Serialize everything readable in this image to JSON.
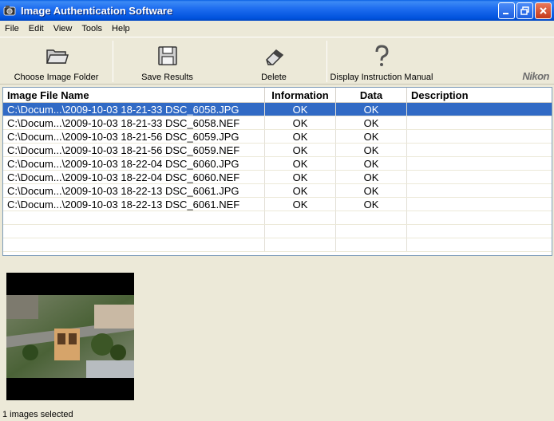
{
  "window": {
    "title": "Image Authentication Software"
  },
  "menu": [
    "File",
    "Edit",
    "View",
    "Tools",
    "Help"
  ],
  "toolbar": {
    "choose_folder": "Choose Image Folder",
    "save_results": "Save Results",
    "delete": "Delete",
    "manual": "Display Instruction Manual",
    "brand": "Nikon"
  },
  "table": {
    "headers": [
      "Image File Name",
      "Information",
      "Data",
      "Description"
    ],
    "rows": [
      {
        "name": "C:\\Docum...\\2009-10-03 18-21-33 DSC_6058.JPG",
        "info": "OK",
        "data": "OK",
        "desc": ""
      },
      {
        "name": "C:\\Docum...\\2009-10-03 18-21-33 DSC_6058.NEF",
        "info": "OK",
        "data": "OK",
        "desc": ""
      },
      {
        "name": "C:\\Docum...\\2009-10-03 18-21-56 DSC_6059.JPG",
        "info": "OK",
        "data": "OK",
        "desc": ""
      },
      {
        "name": "C:\\Docum...\\2009-10-03 18-21-56 DSC_6059.NEF",
        "info": "OK",
        "data": "OK",
        "desc": ""
      },
      {
        "name": "C:\\Docum...\\2009-10-03 18-22-04 DSC_6060.JPG",
        "info": "OK",
        "data": "OK",
        "desc": ""
      },
      {
        "name": "C:\\Docum...\\2009-10-03 18-22-04 DSC_6060.NEF",
        "info": "OK",
        "data": "OK",
        "desc": ""
      },
      {
        "name": "C:\\Docum...\\2009-10-03 18-22-13 DSC_6061.JPG",
        "info": "OK",
        "data": "OK",
        "desc": ""
      },
      {
        "name": "C:\\Docum...\\2009-10-03 18-22-13 DSC_6061.NEF",
        "info": "OK",
        "data": "OK",
        "desc": ""
      }
    ]
  },
  "status": {
    "text": "1 images selected"
  },
  "colors": {
    "selection": "#316ac5",
    "titlebar": "#0052dd"
  }
}
